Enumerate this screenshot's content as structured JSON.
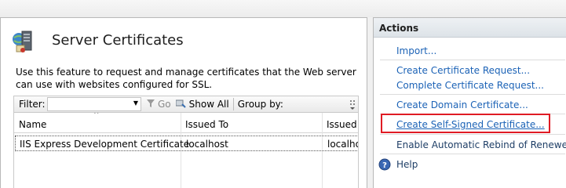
{
  "main": {
    "title": "Server Certificates",
    "description": "Use this feature to request and manage certificates that the Web server can use with websites configured for SSL.",
    "filter_bar": {
      "filter_label": "Filter:",
      "filter_value": "",
      "go_label": "Go",
      "show_all_label": "Show All",
      "group_by_label": "Group by:"
    },
    "table": {
      "columns": [
        "Name",
        "Issued To",
        "Issued B"
      ],
      "rows": [
        {
          "name": "IIS Express Development Certificate",
          "issued_to": "localhost",
          "issued_by": "localhos"
        }
      ]
    }
  },
  "actions": {
    "title": "Actions",
    "items": [
      {
        "label": "Import..."
      },
      {
        "label": "Create Certificate Request..."
      },
      {
        "label": "Complete Certificate Request..."
      },
      {
        "label": "Create Domain Certificate..."
      },
      {
        "label": "Create Self-Signed Certificate..."
      },
      {
        "label": "Enable Automatic Rebind of Renewed Ce"
      },
      {
        "label": "Help"
      }
    ]
  },
  "colors": {
    "link": "#1b62b6",
    "highlight_border": "#e01b24"
  },
  "icons": [
    "server-certificate-icon",
    "dropdown-arrow-icon",
    "filter-go-icon",
    "show-all-icon",
    "help-icon"
  ]
}
